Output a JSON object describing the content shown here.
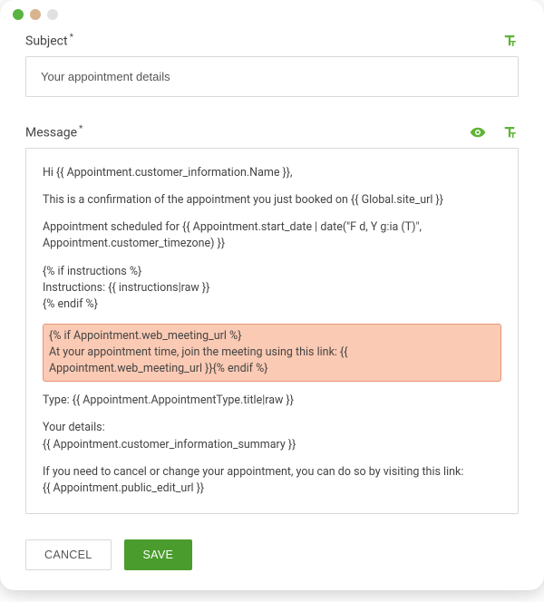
{
  "titlebar": {
    "dots": 3
  },
  "subject": {
    "label": "Subject",
    "required_mark": "*",
    "value": "Your appointment details"
  },
  "message": {
    "label": "Message",
    "required_mark": "*",
    "body": {
      "p1": "Hi {{ Appointment.customer_information.Name }},",
      "p2": "This is a confirmation of the appointment you just booked on {{ Global.site_url }}",
      "p3": "Appointment scheduled for {{ Appointment.start_date | date(\"F d, Y g:ia (T)\", Appointment.customer_timezone) }}",
      "p4": "{% if instructions %}\nInstructions: {{ instructions|raw }}\n{% endif %}",
      "highlight": "{% if Appointment.web_meeting_url %}\nAt your appointment time, join the meeting using this link: {{ Appointment.web_meeting_url }}{% endif %}",
      "p5": "Type: {{ Appointment.AppointmentType.title|raw }}",
      "p6": "Your details:\n{{ Appointment.customer_information_summary }}",
      "p7": "If you need to cancel or change your appointment, you can do so by visiting this link:\n{{ Appointment.public_edit_url }}"
    }
  },
  "buttons": {
    "cancel": "CANCEL",
    "save": "SAVE"
  },
  "colors": {
    "accent": "#5fb336",
    "highlight_bg": "#fbcab4",
    "highlight_border": "#e89574",
    "save_bg": "#4a9c2d"
  },
  "icons": {
    "text_format": "text-format-icon",
    "preview": "eye-icon"
  }
}
